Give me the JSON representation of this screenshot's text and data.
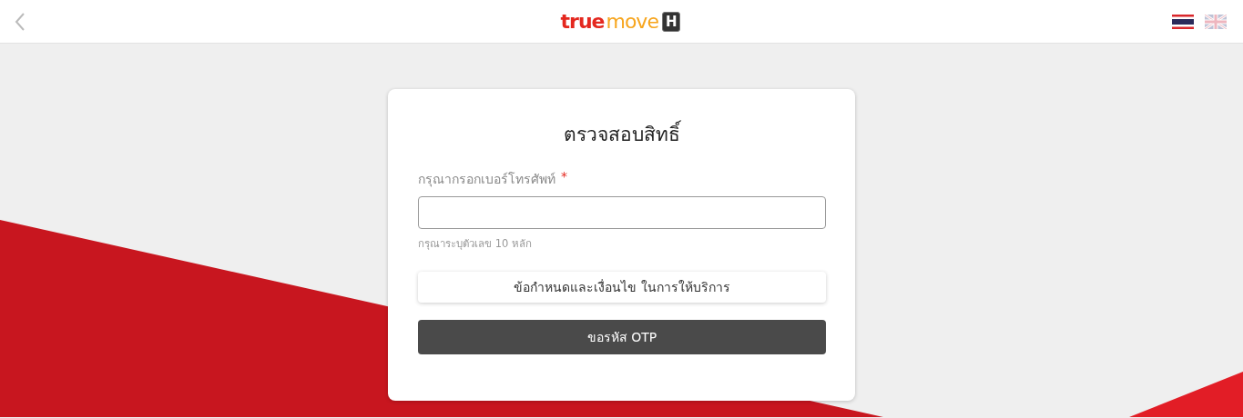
{
  "header": {
    "logo": {
      "word_1": "true",
      "word_2": "move",
      "badge": "H"
    },
    "languages": [
      {
        "kind": "thai",
        "selected": true
      },
      {
        "kind": "english",
        "selected": false
      }
    ]
  },
  "card": {
    "title": "ตรวจสอบสิทธิ์",
    "field": {
      "label": "กรุณากรอกเบอร์โทรศัพท์",
      "required_mark": "*",
      "hint": "กรุณาระบุตัวเลข 10 หลัก"
    },
    "terms_button": "ข้อกำหนดและเงื่อนไข ในการให้บริการ",
    "submit_button": "ขอรหัส OTP"
  }
}
